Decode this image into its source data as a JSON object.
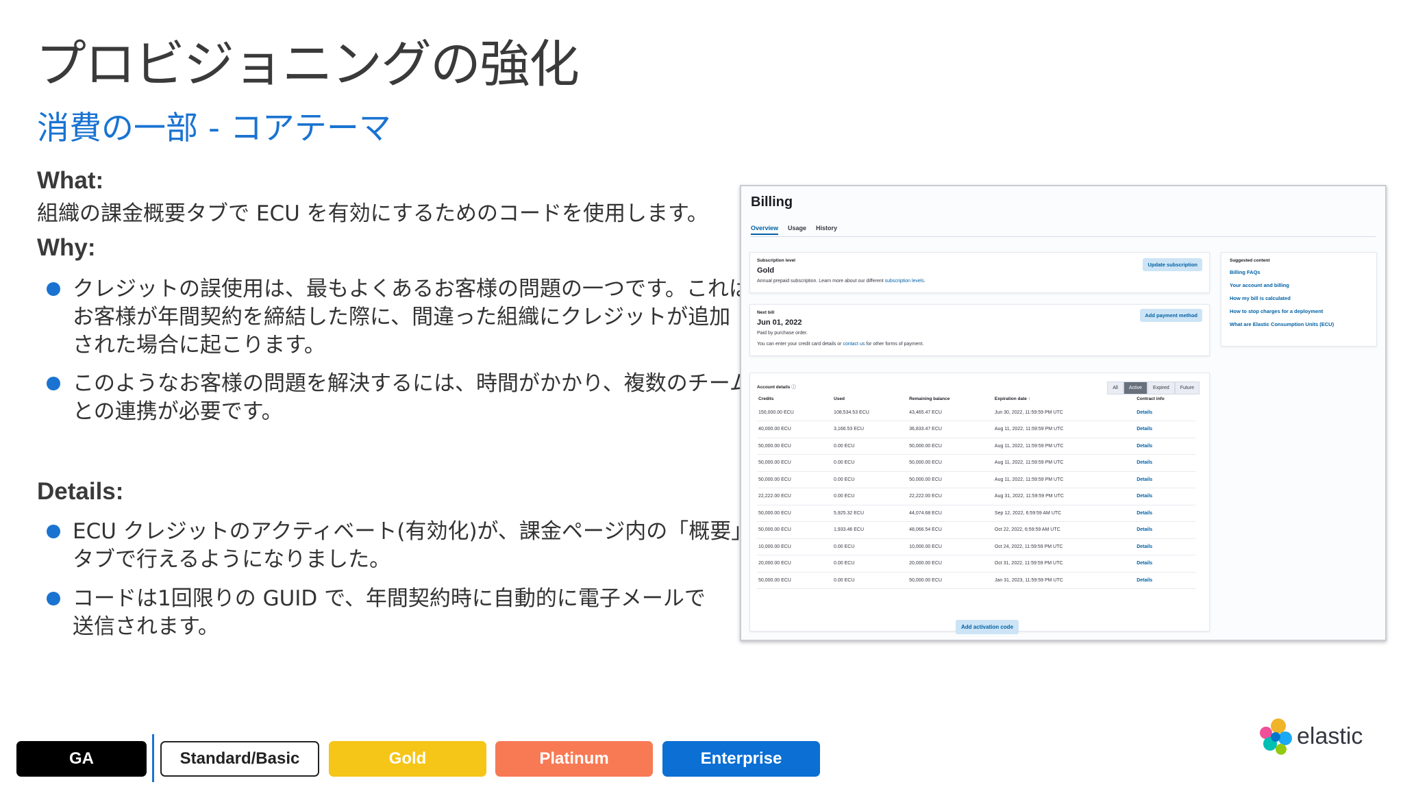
{
  "slide": {
    "title": "プロビジョニングの強化",
    "subtitle": "消費の一部 - コアテーマ"
  },
  "what": {
    "heading": "What:",
    "text": "組織の課金概要タブで ECU を有効にするためのコードを使用します。"
  },
  "why": {
    "heading": "Why:",
    "bullets": [
      [
        "クレジットの誤使用は、最もよくあるお客様の問題の一つです。これは、",
        "お客様が年間契約を締結した際に、間違った組織にクレジットが追加",
        "された場合に起こります。"
      ],
      [
        "このようなお客様の問題を解決するには、時間がかかり、複数のチーム",
        "との連携が必要です。"
      ]
    ]
  },
  "details": {
    "heading": "Details:",
    "bullets": [
      [
        "ECU クレジットのアクティベート(有効化)が、課金ページ内の「概要」",
        "タブで行えるようになりました。"
      ],
      [
        "コードは1回限りの GUID で、年間契約時に自動的に電子メールで",
        "送信されます。"
      ]
    ]
  },
  "billing": {
    "title": "Billing",
    "tabs": [
      "Overview",
      "Usage",
      "History"
    ],
    "subscription": {
      "label": "Subscription level",
      "value": "Gold",
      "desc_prefix": "Annual prepaid subscription. Learn more about our different ",
      "desc_link": "subscription levels.",
      "button": "Update subscription"
    },
    "next_bill": {
      "label": "Next bill",
      "value": "Jun 01, 2022",
      "line1": "Paid by purchase order.",
      "line2_prefix": "You can enter your credit card details or ",
      "line2_link": "contact us",
      "line2_suffix": " for other forms of payment.",
      "button": "Add payment method"
    },
    "suggested": {
      "heading": "Suggested content",
      "links": [
        "Billing FAQs",
        "Your account and billing",
        "How my bill is calculated",
        "How to stop charges for a deployment",
        "What are Elastic Consumption Units (ECU)"
      ]
    },
    "account": {
      "heading": "Account details",
      "filters": [
        "All",
        "Active",
        "Expired",
        "Future"
      ],
      "active_filter": "Active",
      "columns": [
        "Credits",
        "Used",
        "Remaining balance",
        "Expiration date",
        "Contract info"
      ],
      "rows": [
        [
          "150,000.00 ECU",
          "108,534.53 ECU",
          "43,465.47 ECU",
          "Jun 30, 2022, 11:59:59 PM UTC",
          "Details"
        ],
        [
          "40,000.00 ECU",
          "3,166.53 ECU",
          "36,833.47 ECU",
          "Aug 11, 2022, 11:59:59 PM UTC",
          "Details"
        ],
        [
          "50,000.00 ECU",
          "0.00 ECU",
          "50,000.00 ECU",
          "Aug 11, 2022, 11:59:59 PM UTC",
          "Details"
        ],
        [
          "50,000.00 ECU",
          "0.00 ECU",
          "50,000.00 ECU",
          "Aug 11, 2022, 11:59:59 PM UTC",
          "Details"
        ],
        [
          "50,000.00 ECU",
          "0.00 ECU",
          "50,000.00 ECU",
          "Aug 11, 2022, 11:59:59 PM UTC",
          "Details"
        ],
        [
          "22,222.00 ECU",
          "0.00 ECU",
          "22,222.00 ECU",
          "Aug 31, 2022, 11:59:59 PM UTC",
          "Details"
        ],
        [
          "50,000.00 ECU",
          "5,925.32 ECU",
          "44,074.68 ECU",
          "Sep 12, 2022, 6:59:59 AM UTC",
          "Details"
        ],
        [
          "50,000.00 ECU",
          "1,933.46 ECU",
          "48,066.54 ECU",
          "Oct 22, 2022, 6:59:59 AM UTC",
          "Details"
        ],
        [
          "10,000.00 ECU",
          "0.00 ECU",
          "10,000.00 ECU",
          "Oct 24, 2022, 11:59:59 PM UTC",
          "Details"
        ],
        [
          "20,000.00 ECU",
          "0.00 ECU",
          "20,000.00 ECU",
          "Oct 31, 2022, 11:59:59 PM UTC",
          "Details"
        ],
        [
          "50,000.00 ECU",
          "0.00 ECU",
          "50,000.00 ECU",
          "Jan 31, 2023, 11:59:59 PM UTC",
          "Details"
        ]
      ],
      "add_button": "Add activation code"
    }
  },
  "tiers": [
    {
      "label": "GA",
      "bg": "#000000",
      "fg": "#ffffff"
    },
    {
      "label": "Standard/Basic",
      "bg": "#ffffff",
      "fg": "#222222"
    },
    {
      "label": "Gold",
      "bg": "#f5c518",
      "fg": "#ffffff"
    },
    {
      "label": "Platinum",
      "bg": "#f77a55",
      "fg": "#ffffff"
    },
    {
      "label": "Enterprise",
      "bg": "#0b6fd4",
      "fg": "#ffffff"
    }
  ],
  "logo": {
    "text": "elastic",
    "icon": "elastic-logo-icon"
  }
}
